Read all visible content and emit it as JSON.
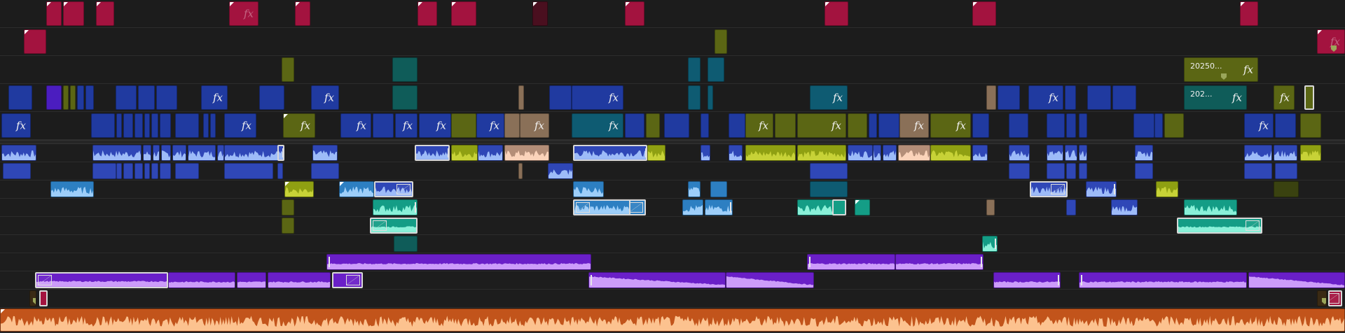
{
  "timeline": {
    "fx_label": "fx",
    "clip_names": {
      "c1": "20250...",
      "c2": "202..."
    },
    "colors": {
      "magenta": "#a3133f",
      "magenta_dark": "#4a0f1f",
      "olive": "#5b6614",
      "teal_video": "#0f5c59",
      "teal_blue": "#0e5b72",
      "blue": "#203aa0",
      "violet": "#4b1dbf",
      "tan": "#8a7058",
      "audio_blue": "#2f47b7",
      "audio_lime": "#8fa012",
      "audio_peach": "#b48e78",
      "audio_sky": "#2d7fc2",
      "audio_mint": "#149d86",
      "audio_purple": "#6a1fc8",
      "audio_orange": "#c2541b",
      "waveform_light": "#a7c8ff"
    }
  }
}
